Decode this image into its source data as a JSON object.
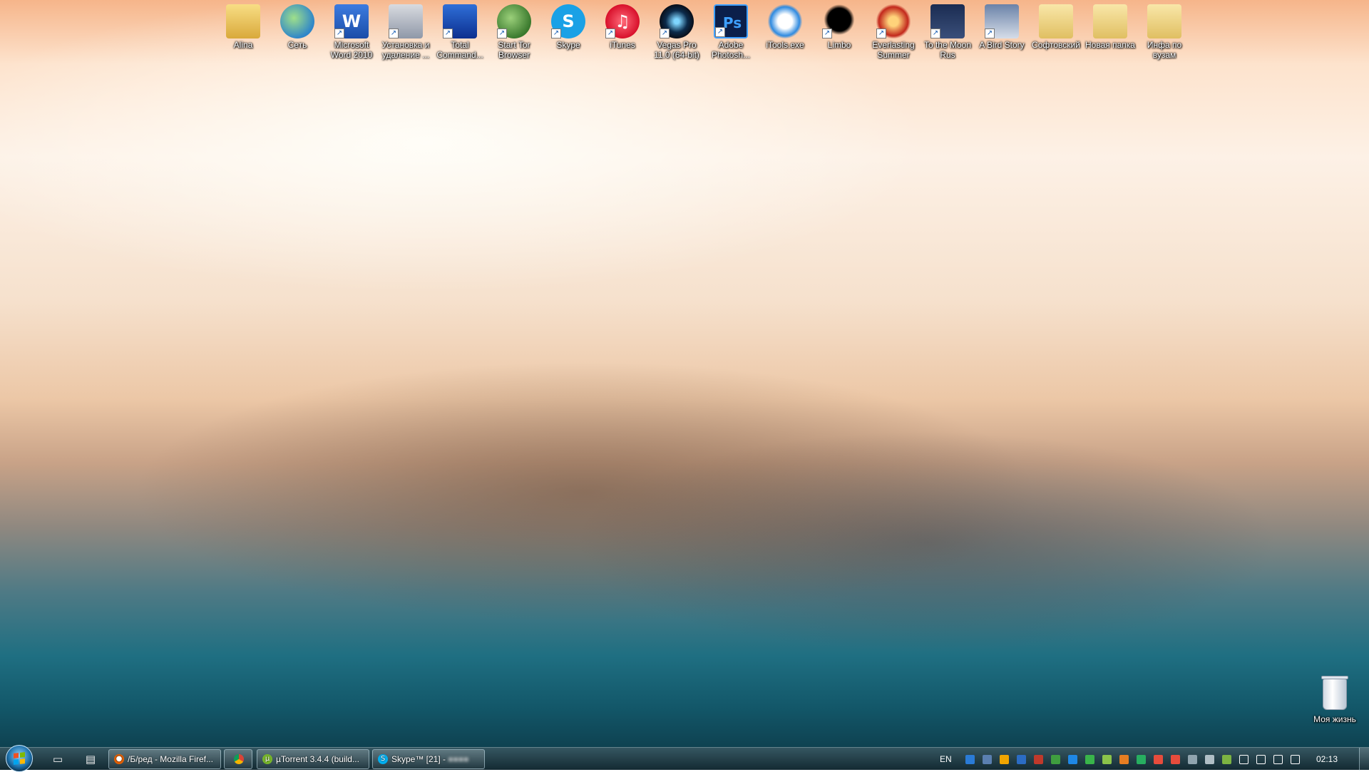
{
  "desktop": {
    "icons": [
      {
        "label": "Alina",
        "icon": "user-folder-icon",
        "shortcut": false
      },
      {
        "label": "Сеть",
        "icon": "network-globe-icon",
        "shortcut": false
      },
      {
        "label": "Microsoft Word 2010",
        "icon": "word-icon",
        "shortcut": true,
        "glyph": "W"
      },
      {
        "label": "Установка и удаление ...",
        "icon": "programs-icon",
        "shortcut": true
      },
      {
        "label": "Total Command...",
        "icon": "floppy-disk-icon",
        "shortcut": true
      },
      {
        "label": "Start Tor Browser",
        "icon": "tor-globe-icon",
        "shortcut": true
      },
      {
        "label": "Skype",
        "icon": "skype-icon",
        "shortcut": true,
        "glyph": "S"
      },
      {
        "label": "iTunes",
        "icon": "itunes-icon",
        "shortcut": true,
        "glyph": "♫"
      },
      {
        "label": "Vegas Pro 11.0 (64-bit)",
        "icon": "vegas-lens-icon",
        "shortcut": true
      },
      {
        "label": "Adobe Photosh...",
        "icon": "photoshop-icon",
        "shortcut": true,
        "glyph": "Ps"
      },
      {
        "label": "iTools.exe",
        "icon": "itools-eye-icon",
        "shortcut": false
      },
      {
        "label": "Limbo",
        "icon": "limbo-silhouette-icon",
        "shortcut": true
      },
      {
        "label": "Everlasting Summer",
        "icon": "star-icon",
        "shortcut": true
      },
      {
        "label": "To the Moon Rus",
        "icon": "moon-game-icon",
        "shortcut": true
      },
      {
        "label": "A Bird Story",
        "icon": "bird-story-icon",
        "shortcut": true
      },
      {
        "label": "Софтовский",
        "icon": "folder-icon",
        "shortcut": false
      },
      {
        "label": "Новая папка",
        "icon": "folder-icon",
        "shortcut": false
      },
      {
        "label": "Инфа по вузам",
        "icon": "folder-icon",
        "shortcut": false
      }
    ],
    "recycle_bin": {
      "label": "Моя жизнь",
      "icon": "recycle-bin-icon"
    }
  },
  "taskbar": {
    "start": {
      "icon": "windows-start-icon"
    },
    "pinned": [
      {
        "icon": "explorer-folder-icon",
        "glyph": "▭"
      },
      {
        "icon": "media-clapper-icon",
        "glyph": "▤"
      }
    ],
    "buttons": [
      {
        "label": "/Б/ред - Mozilla Firef...",
        "icon": "firefox-icon",
        "color": "#e66000"
      },
      {
        "label": "",
        "icon": "chrome-icon",
        "color": "#db4437"
      },
      {
        "label": "µTorrent 3.4.4  (build...",
        "icon": "utorrent-icon",
        "color": "#78b72a"
      },
      {
        "label": "Skype™ [21] - ",
        "icon": "skype-icon",
        "color": "#00aff0"
      }
    ],
    "tray": {
      "language": "EN",
      "icons": [
        "lightning-icon",
        "tool-icon",
        "orange-circle-icon",
        "shield-icon",
        "media-icon",
        "speaker-device-icon",
        "transfer-icon",
        "chat-icon",
        "card-icon",
        "box-icon",
        "green-circle-icon",
        "antivirus-icon",
        "volume-red-icon",
        "monitor-icon",
        "network-icon",
        "tree-icon",
        "flag-icon",
        "signal-icon",
        "device-icon",
        "volume-icon"
      ],
      "clock": "02:13"
    }
  },
  "colors": {
    "tray_icons": [
      "#2a7bd6",
      "#5a7fb0",
      "#f0a500",
      "#2b6cc4",
      "#c0392b",
      "#3f9e3f",
      "#1e88e5",
      "#39b54a",
      "#8bc34a",
      "#e67e22",
      "#27ae60",
      "#e74c3c",
      "#e74c3c",
      "#90a4ae",
      "#b0bec5",
      "#7cb342",
      "#ffffff",
      "#ffffff",
      "#ffffff",
      "#ffffff"
    ]
  }
}
